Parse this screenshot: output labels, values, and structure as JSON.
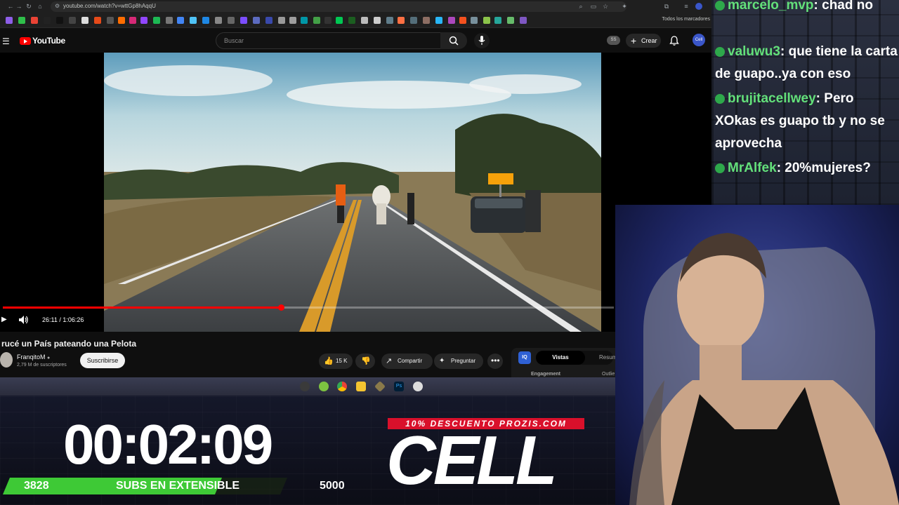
{
  "browser": {
    "url": "youtube.com/watch?v=wttGp8hAqqU",
    "bookmarks_all_label": "Todos los marcadores"
  },
  "youtube": {
    "logo_text": "YouTube",
    "search_placeholder": "Buscar",
    "user_badge": "SS",
    "create_label": "Crear",
    "avatar_initials": "Cell"
  },
  "player": {
    "time_current": "26:11",
    "time_total": "1:06:26",
    "time_display": "26:11 / 1:06:26",
    "progress_fraction": 0.455
  },
  "video": {
    "title": "rucé un País pateando una Pelota",
    "channel_name": "FranqitoM",
    "subscribers": "2,79 M de suscriptores",
    "subscribe_label": "Suscribirse",
    "likes": "15 K",
    "share_label": "Compartir",
    "ask_label": "Preguntar"
  },
  "analytics_panel": {
    "badge": "IQ",
    "tab_active": "Vistas",
    "tab_inactive": "Resum",
    "engagement_label": "Engagement",
    "outlier_label": "Outlie"
  },
  "overlay": {
    "timer": "00:02:09",
    "subs_current": "3828",
    "subs_label": "SUBS EN EXTENSIBLE",
    "subs_goal": "5000",
    "subs_progress_fraction": 0.7656,
    "promo": "10% DESCUENTO PROZIS.COM",
    "brand": "CELL"
  },
  "chat": {
    "messages": [
      {
        "user": "marcelo_mvp",
        "text": ": chad no"
      },
      {
        "user": "valuwu3",
        "text": ": que tiene la carta de guapo..ya con eso"
      },
      {
        "user": "brujitacellwey",
        "text": ": Pero XOkas es guapo tb y no se aprovecha"
      },
      {
        "user": "MrAlfek",
        "text": ": 20%mujeres?"
      }
    ]
  },
  "colors": {
    "yt_red": "#ff0000",
    "chat_user": "#63e07a",
    "promo_red": "#d9102b",
    "subs_green": "#3ec936"
  }
}
